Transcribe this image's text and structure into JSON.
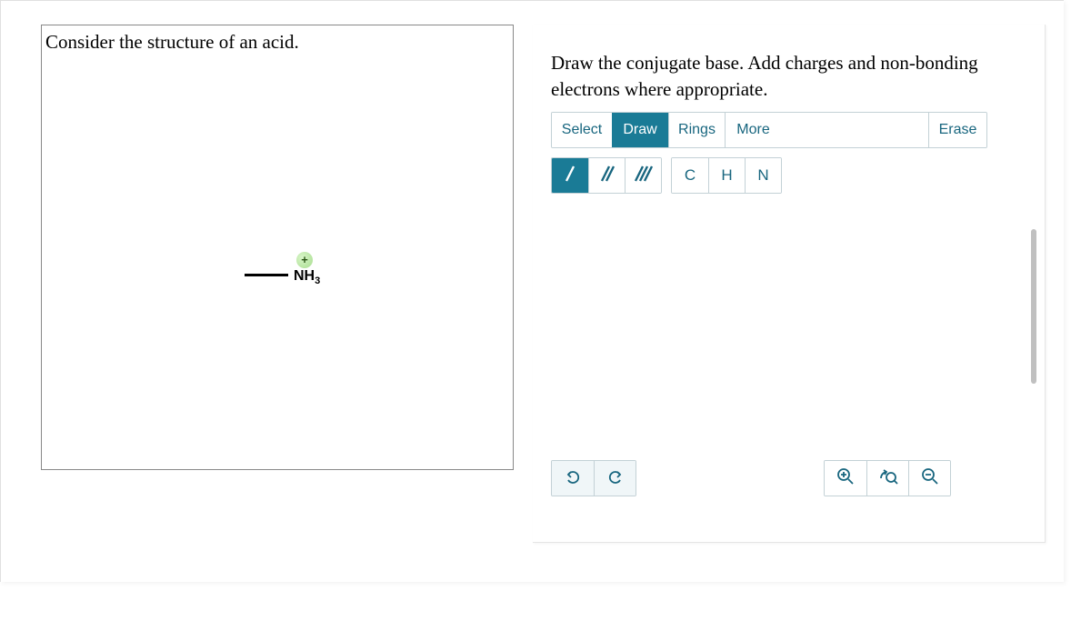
{
  "left": {
    "title": "Consider the structure of an acid.",
    "structure": {
      "charge": "+",
      "label_html": "NH",
      "label_sub": "3"
    }
  },
  "right": {
    "instruction": "Draw the conjugate base. Add charges and non-bonding electrons where appropriate.",
    "tabs": {
      "select": "Select",
      "draw": "Draw",
      "rings": "Rings",
      "more": "More",
      "erase": "Erase",
      "active": "draw"
    },
    "bonds": {
      "single": "/",
      "double": "//",
      "triple": "///",
      "active": "single"
    },
    "atoms": {
      "c": "C",
      "h": "H",
      "n": "N"
    }
  }
}
